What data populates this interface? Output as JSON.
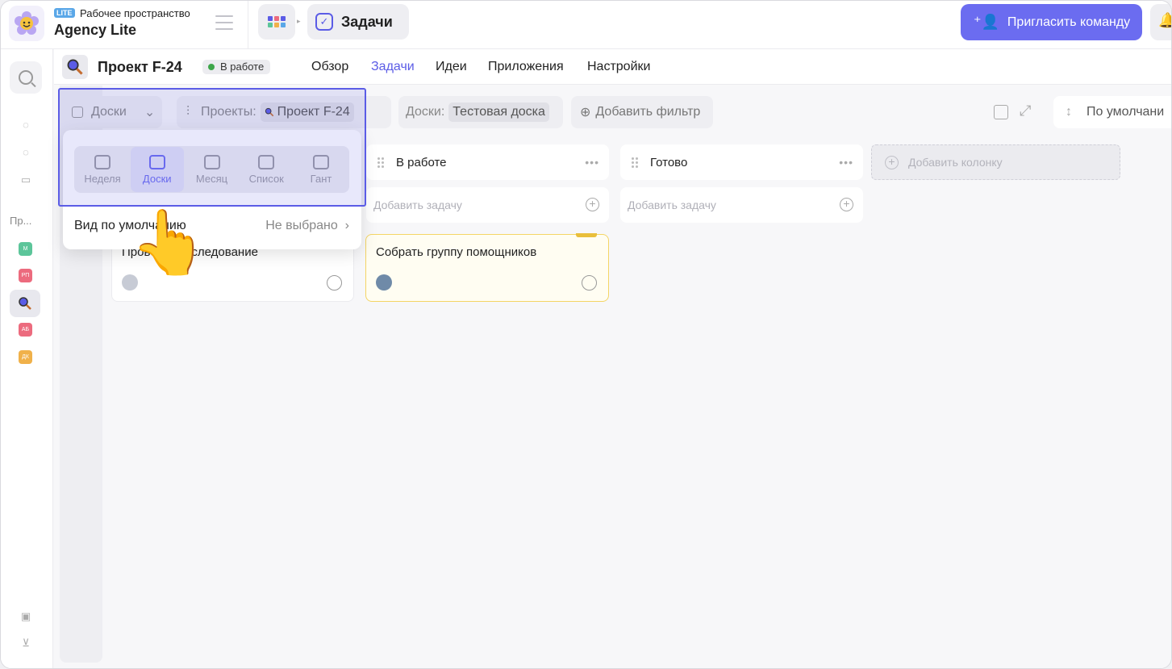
{
  "topbar": {
    "workspace_badge": "LITE",
    "workspace_sub": "Рабочее пространство",
    "workspace_title": "Agency Lite",
    "current_app": "Задачи",
    "invite_label": "Пригласить команду"
  },
  "sidebar": {
    "section_label": "Пр...",
    "projects": [
      {
        "abbr": "М",
        "color": "#5cc59a"
      },
      {
        "abbr": "РП",
        "color": "#ec6b7e"
      },
      {
        "abbr": "",
        "color": "#5b5ce6"
      },
      {
        "abbr": "АБ",
        "color": "#ec6b7e"
      },
      {
        "abbr": "ДК",
        "color": "#f0b14a"
      }
    ]
  },
  "project": {
    "title": "Проект F-24",
    "status": "В работе",
    "tabs": [
      {
        "label": "Обзор",
        "active": false
      },
      {
        "label": "Задачи",
        "active": true
      },
      {
        "label": "Идеи",
        "active": false
      },
      {
        "label": "Приложения",
        "active": false
      },
      {
        "label": "Настройки",
        "active": false
      }
    ]
  },
  "filters": {
    "view_label": "Доски",
    "projects_label": "Проекты:",
    "projects_value": "Проект F-24",
    "boards_label": "Доски:",
    "boards_value": "Тестовая доска",
    "add_filter": "Добавить фильтр",
    "sort_label": "По умолчани"
  },
  "columns": [
    {
      "title": "В работе",
      "add_task": "Добавить задачу"
    },
    {
      "title": "Готово",
      "add_task": "Добавить задачу"
    }
  ],
  "add_column": "Добавить колонку",
  "cards": [
    {
      "title": "Провести исследование"
    },
    {
      "title": "Собрать группу помощников"
    }
  ],
  "popover": {
    "views": [
      {
        "label": "Неделя",
        "active": false
      },
      {
        "label": "Доски",
        "active": true
      },
      {
        "label": "Месяц",
        "active": false
      },
      {
        "label": "Список",
        "active": false
      },
      {
        "label": "Гант",
        "active": false
      }
    ],
    "default_label": "Вид по умолчанию",
    "default_value": "Не выбрано"
  },
  "colors": {
    "accent": "#5b5ce6",
    "invite_bg": "#6b6cf0",
    "status_dot": "#3ea64a",
    "card_highlight": "#f4d565"
  }
}
